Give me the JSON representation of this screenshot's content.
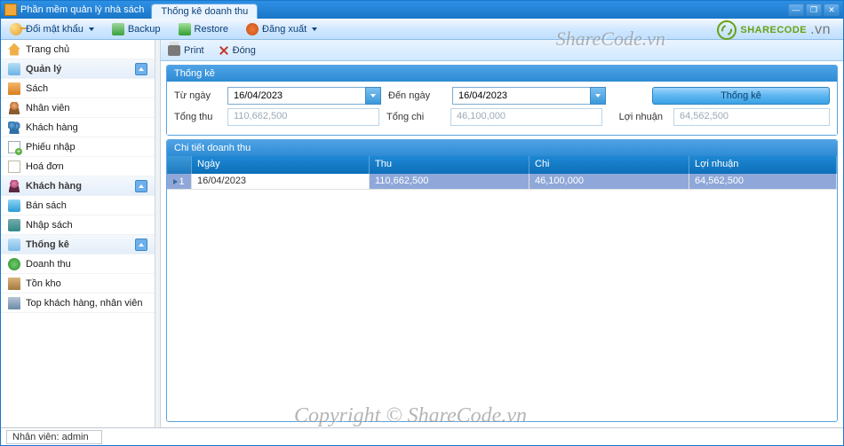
{
  "window": {
    "app_title": "Phần mềm quản lý nhà sách",
    "active_tab": "Thống kê doanh thu"
  },
  "win_controls": {
    "min": "—",
    "max": "❐",
    "close": "✕"
  },
  "toolbar": {
    "change_password": "Đổi mật khẩu",
    "backup": "Backup",
    "restore": "Restore",
    "logout": "Đăng xuất"
  },
  "sharecode": {
    "brand": "SHARECODE",
    "suffix": ".vn"
  },
  "watermark": "ShareCode.vn",
  "watermark2": "Copyright © ShareCode.vn",
  "sidebar": {
    "home": "Trang chủ",
    "g_quanly": "Quản lý",
    "sach": "Sách",
    "nhanvien": "Nhân viên",
    "khachhang": "Khách hàng",
    "phieunhap": "Phiếu nhập",
    "hoadon": "Hoá đơn",
    "g_khachhang": "Khách hàng",
    "bansach": "Bán sách",
    "nhapsach": "Nhập sách",
    "g_thongke": "Thống kê",
    "doanhthu": "Doanh thu",
    "tonkho": "Tồn kho",
    "top": "Top khách hàng, nhân viên"
  },
  "subtoolbar": {
    "print": "Print",
    "close": "Đóng"
  },
  "filter_panel": {
    "title": "Thống kê",
    "from_label": "Từ ngày",
    "from_value": "16/04/2023",
    "to_label": "Đến ngày",
    "to_value": "16/04/2023",
    "tongthu_label": "Tổng thu",
    "tongthu_value": "110,662,500",
    "tongchi_label": "Tổng chi",
    "tongchi_value": "46,100,000",
    "loinhuan_label": "Lợi nhuận",
    "loinhuan_value": "64,562,500",
    "button": "Thống kê"
  },
  "grid": {
    "title": "Chi tiết doanh thu",
    "columns": {
      "ngay": "Ngày",
      "thu": "Thu",
      "chi": "Chi",
      "loinhuan": "Lợi nhuận"
    },
    "row_indicator": "1",
    "rows": [
      {
        "ngay": "16/04/2023",
        "thu": "110,662,500",
        "chi": "46,100,000",
        "loinhuan": "64,562,500"
      }
    ]
  },
  "statusbar": {
    "user_label": "Nhân viên: admin"
  }
}
